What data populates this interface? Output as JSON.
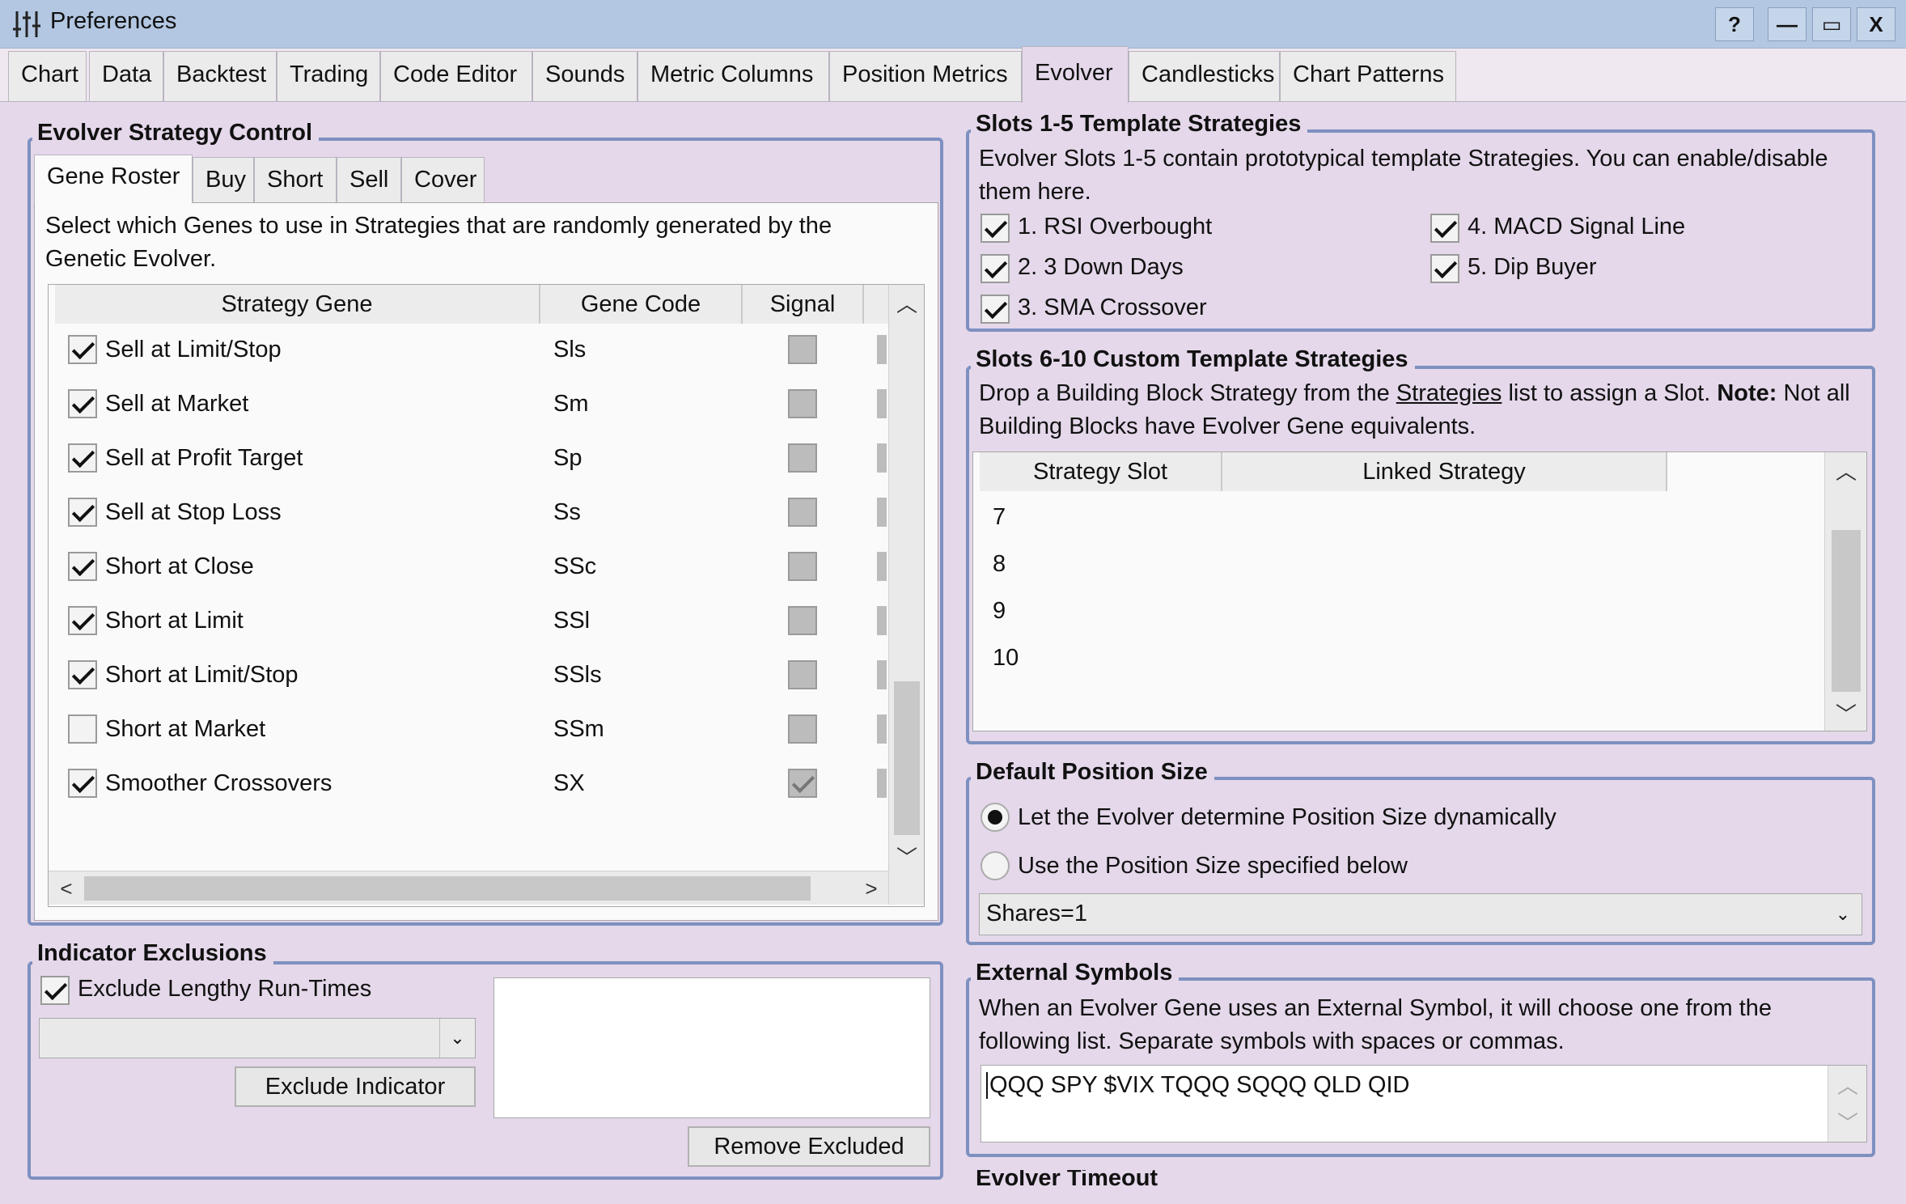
{
  "window": {
    "title": "Preferences",
    "help": "?",
    "minimize": "—",
    "maximize": "▭",
    "close": "X"
  },
  "tabs": [
    "Chart",
    "Data",
    "Backtest",
    "Trading",
    "Code Editor",
    "Sounds",
    "Metric Columns",
    "Position Metrics",
    "Evolver",
    "Candlesticks",
    "Chart Patterns"
  ],
  "active_tab": "Evolver",
  "evolver_control": {
    "title": "Evolver Strategy Control",
    "subtabs": [
      "Gene Roster",
      "Buy",
      "Short",
      "Sell",
      "Cover"
    ],
    "active_subtab": "Gene Roster",
    "description": "Select which Genes to use in Strategies that are randomly generated by the Genetic Evolver.",
    "columns": [
      "Strategy Gene",
      "Gene Code",
      "Signal"
    ],
    "rows": [
      {
        "enabled": true,
        "gene": "Sell at Limit/Stop",
        "code": "Sls",
        "signal": false
      },
      {
        "enabled": true,
        "gene": "Sell at Market",
        "code": "Sm",
        "signal": false
      },
      {
        "enabled": true,
        "gene": "Sell at Profit Target",
        "code": "Sp",
        "signal": false
      },
      {
        "enabled": true,
        "gene": "Sell at Stop Loss",
        "code": "Ss",
        "signal": false
      },
      {
        "enabled": true,
        "gene": "Short at Close",
        "code": "SSc",
        "signal": false
      },
      {
        "enabled": true,
        "gene": "Short at Limit",
        "code": "SSl",
        "signal": false
      },
      {
        "enabled": true,
        "gene": "Short at Limit/Stop",
        "code": "SSls",
        "signal": false
      },
      {
        "enabled": false,
        "gene": "Short at Market",
        "code": "SSm",
        "signal": false
      },
      {
        "enabled": true,
        "gene": "Smoother Crossovers",
        "code": "SX",
        "signal": true
      }
    ]
  },
  "indicator_exclusions": {
    "title": "Indicator Exclusions",
    "exclude_lengthy_label": "Exclude Lengthy Run-Times",
    "exclude_lengthy_checked": true,
    "exclude_button": "Exclude Indicator",
    "remove_button": "Remove Excluded"
  },
  "slots_1_5": {
    "title": "Slots 1-5 Template Strategies",
    "description": "Evolver Slots 1-5 contain prototypical template Strategies. You can enable/disable them here.",
    "items": [
      {
        "label": "1. RSI Overbought",
        "checked": true
      },
      {
        "label": "2. 3 Down Days",
        "checked": true
      },
      {
        "label": "3. SMA Crossover",
        "checked": true
      },
      {
        "label": "4. MACD Signal Line",
        "checked": true
      },
      {
        "label": "5. Dip Buyer",
        "checked": true
      }
    ]
  },
  "slots_6_10": {
    "title": "Slots 6-10 Custom Template Strategies",
    "desc_prefix": "Drop a Building Block Strategy from the ",
    "desc_link": "Strategies",
    "desc_mid": " list to assign a Slot. ",
    "desc_bold": "Note:",
    "desc_suffix": " Not all Building Blocks have Evolver Gene equivalents.",
    "columns": [
      "Strategy Slot",
      "Linked Strategy"
    ],
    "rows": [
      "7",
      "8",
      "9",
      "10"
    ]
  },
  "position_size": {
    "title": "Default Position Size",
    "option_dynamic": "Let the Evolver determine Position Size dynamically",
    "option_specified": "Use the Position Size specified below",
    "selected": "dynamic",
    "size_value": "Shares=1"
  },
  "external_symbols": {
    "title": "External Symbols",
    "description": "When an Evolver Gene uses an External Symbol, it will choose one from the following list. Separate symbols with spaces or commas.",
    "value": "QQQ SPY $VIX TQQQ SQQQ QLD QID"
  },
  "evolver_timeout": {
    "title": "Evolver Timeout"
  }
}
